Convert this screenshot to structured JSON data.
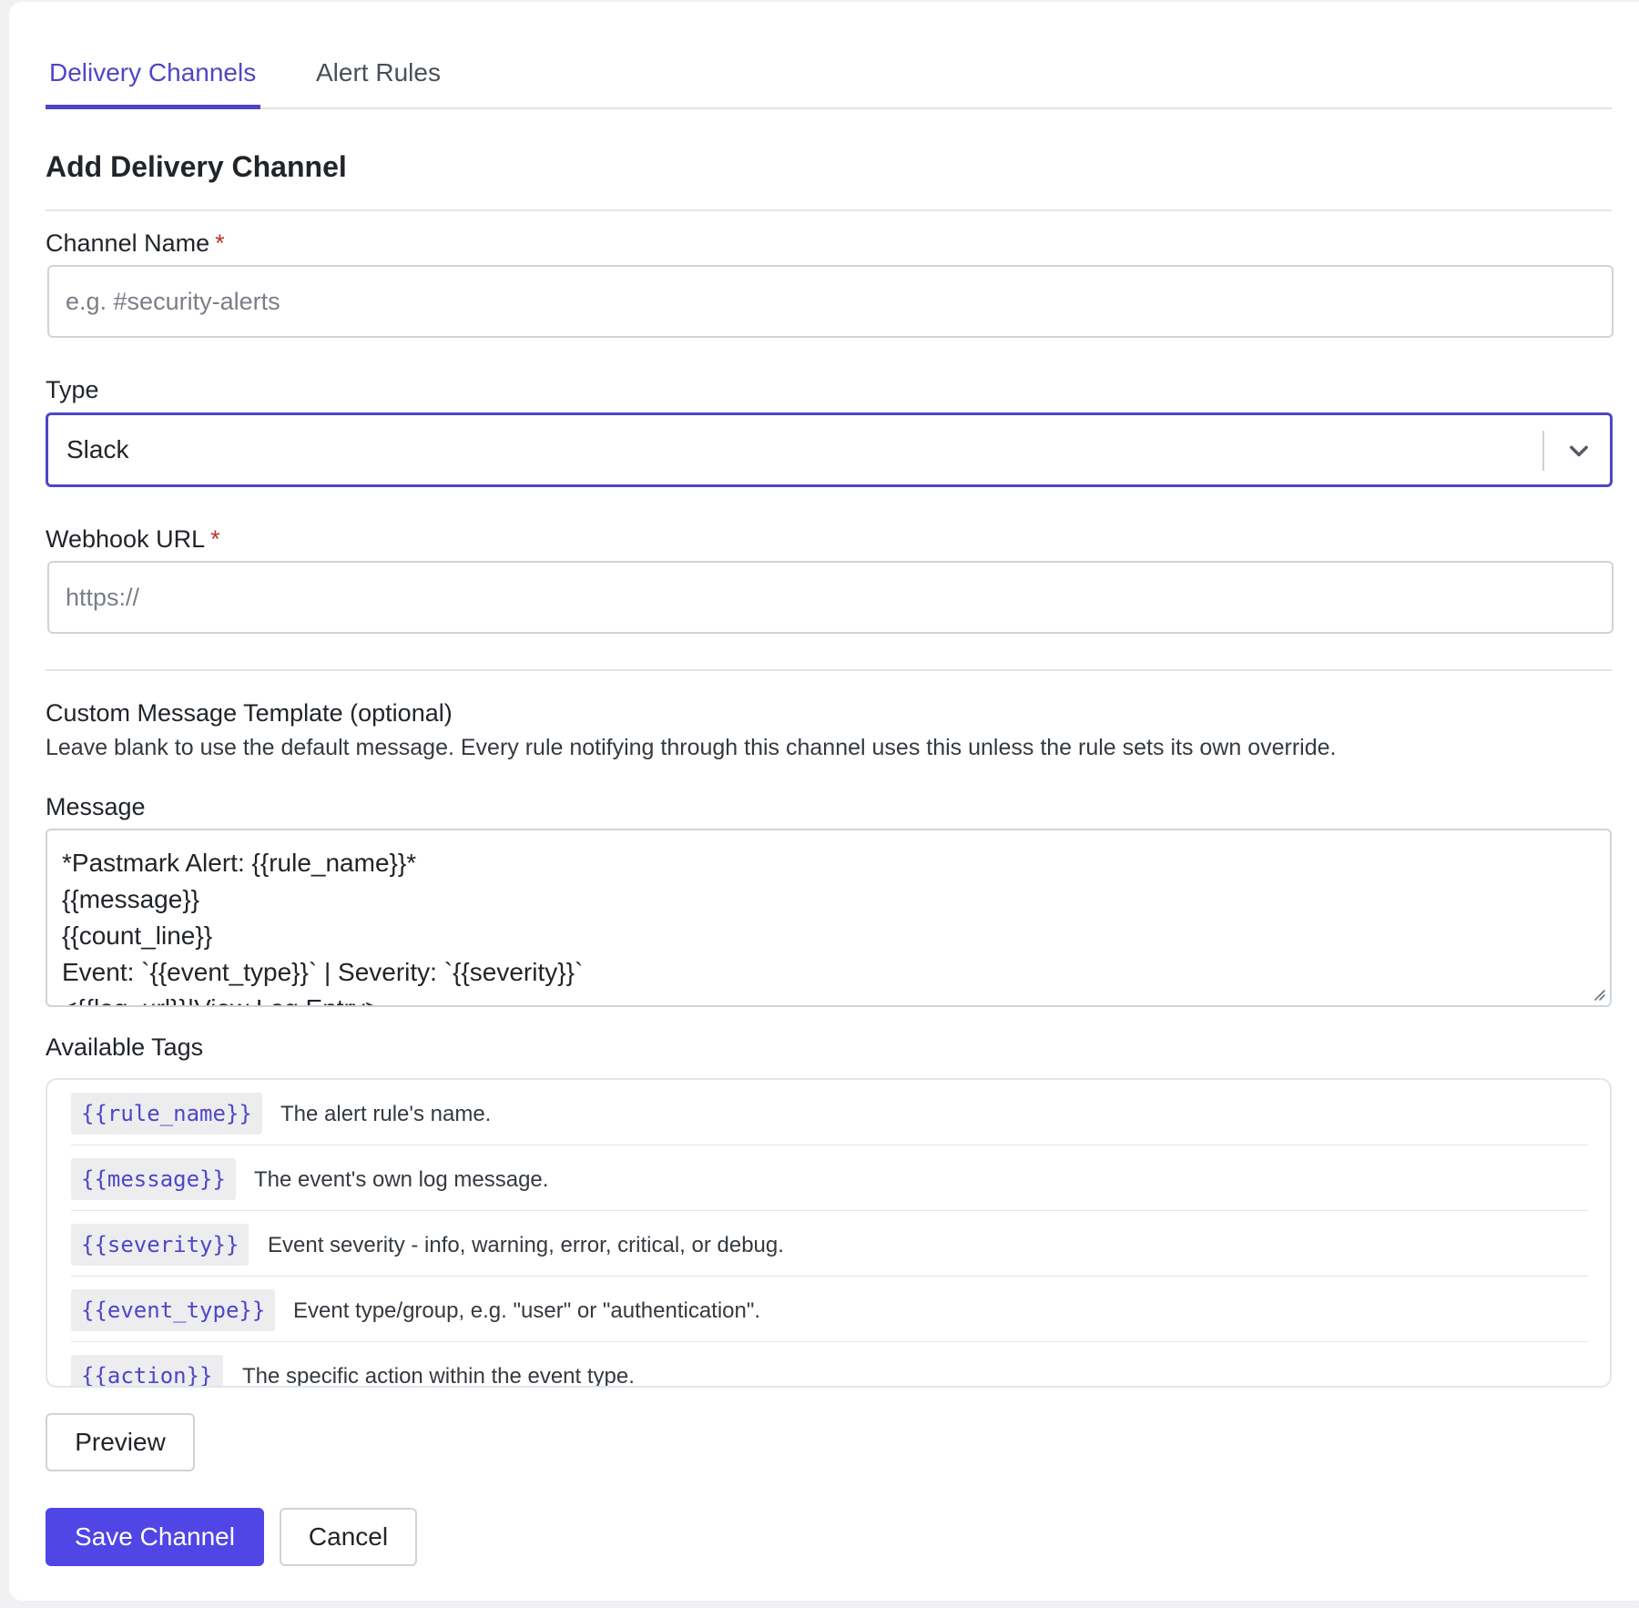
{
  "tabs": [
    {
      "label": "Delivery Channels",
      "active": true
    },
    {
      "label": "Alert Rules",
      "active": false
    }
  ],
  "form": {
    "title": "Add Delivery Channel",
    "required_mark": "*",
    "channel_name": {
      "label": "Channel Name",
      "value": "",
      "placeholder": "e.g. #security-alerts"
    },
    "type": {
      "label": "Type",
      "selected": "Slack"
    },
    "webhook_url": {
      "label": "Webhook URL",
      "value": "",
      "placeholder": "https://"
    },
    "template": {
      "title": "Custom Message Template (optional)",
      "help": "Leave blank to use the default message. Every rule notifying through this channel uses this unless the rule sets its own override.",
      "message_label": "Message",
      "message_lines": [
        "*Pastmark Alert: {{rule_name}}*",
        "{{message}}",
        "{{count_line}}",
        "Event: `{{event_type}}` | Severity: `{{severity}}`",
        "<{{log_url}}|View Log Entry>"
      ]
    },
    "available_tags": {
      "label": "Available Tags",
      "items": [
        {
          "tag": "{{rule_name}}",
          "description": "The alert rule's name."
        },
        {
          "tag": "{{message}}",
          "description": "The event's own log message."
        },
        {
          "tag": "{{severity}}",
          "description": "Event severity - info, warning, error, critical, or debug."
        },
        {
          "tag": "{{event_type}}",
          "description": "Event type/group, e.g. \"user\" or \"authentication\"."
        },
        {
          "tag": "{{action}}",
          "description": "The specific action within the event type."
        }
      ]
    },
    "buttons": {
      "preview": "Preview",
      "save": "Save Channel",
      "cancel": "Cancel"
    }
  },
  "colors": {
    "accent": "#4f46e5",
    "required": "#c0322a",
    "tag_text": "#4f46c7"
  },
  "icons": {
    "select_chevron": "chevron-down-icon",
    "textarea_resize": "resize-grip-icon"
  }
}
